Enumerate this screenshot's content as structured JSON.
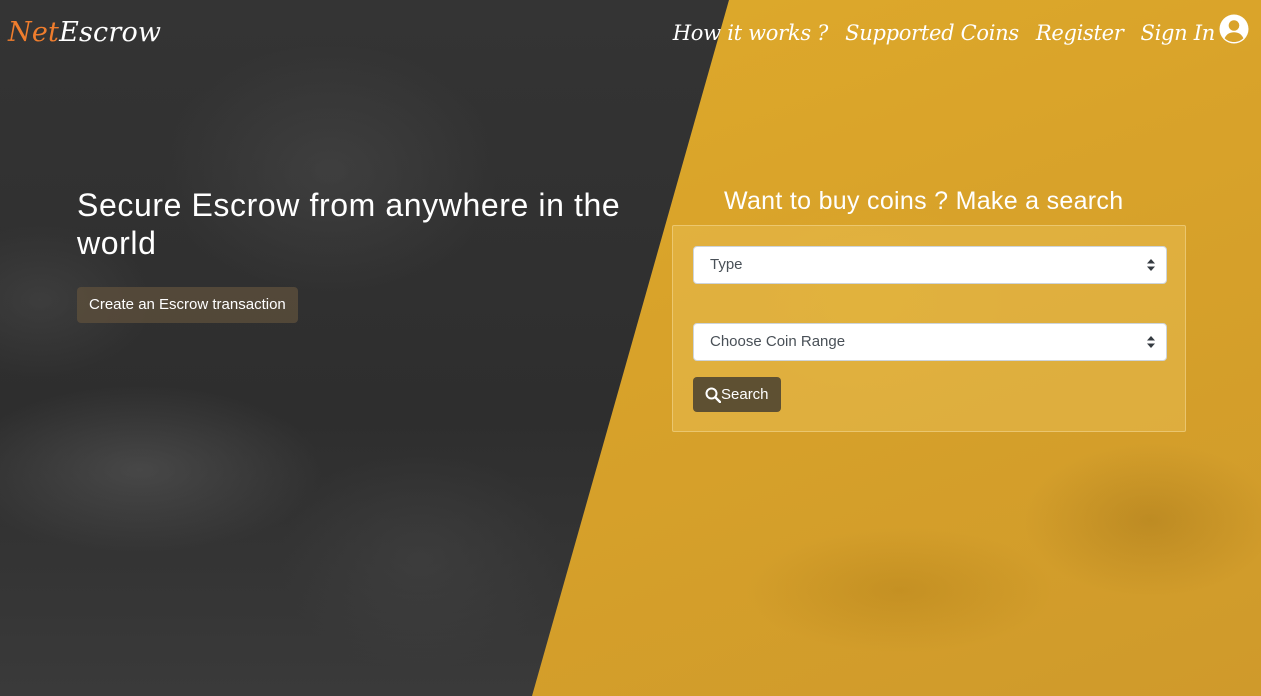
{
  "brand": {
    "part1": "Net",
    "part2": "Escrow"
  },
  "nav": {
    "how_it_works": "How it works ?",
    "supported_coins": "Supported Coins",
    "register": "Register",
    "sign_in": "Sign In"
  },
  "hero": {
    "title": "Secure Escrow from anywhere in the world",
    "cta_label": "Create an Escrow transaction"
  },
  "search": {
    "title": "Want to buy coins ? Make a search",
    "type_select": {
      "selected": "Type"
    },
    "range_select": {
      "selected": "Choose Coin Range"
    },
    "button_label": "Search"
  },
  "colors": {
    "brand_accent": "#f07d2d",
    "panel_yellow": "#d9a32a",
    "dark_background": "#2f2f2f",
    "search_button": "#5e5032"
  },
  "icons": {
    "user": "user-circle-icon",
    "search": "search-icon",
    "select_arrows": "sort-arrows-icon"
  }
}
